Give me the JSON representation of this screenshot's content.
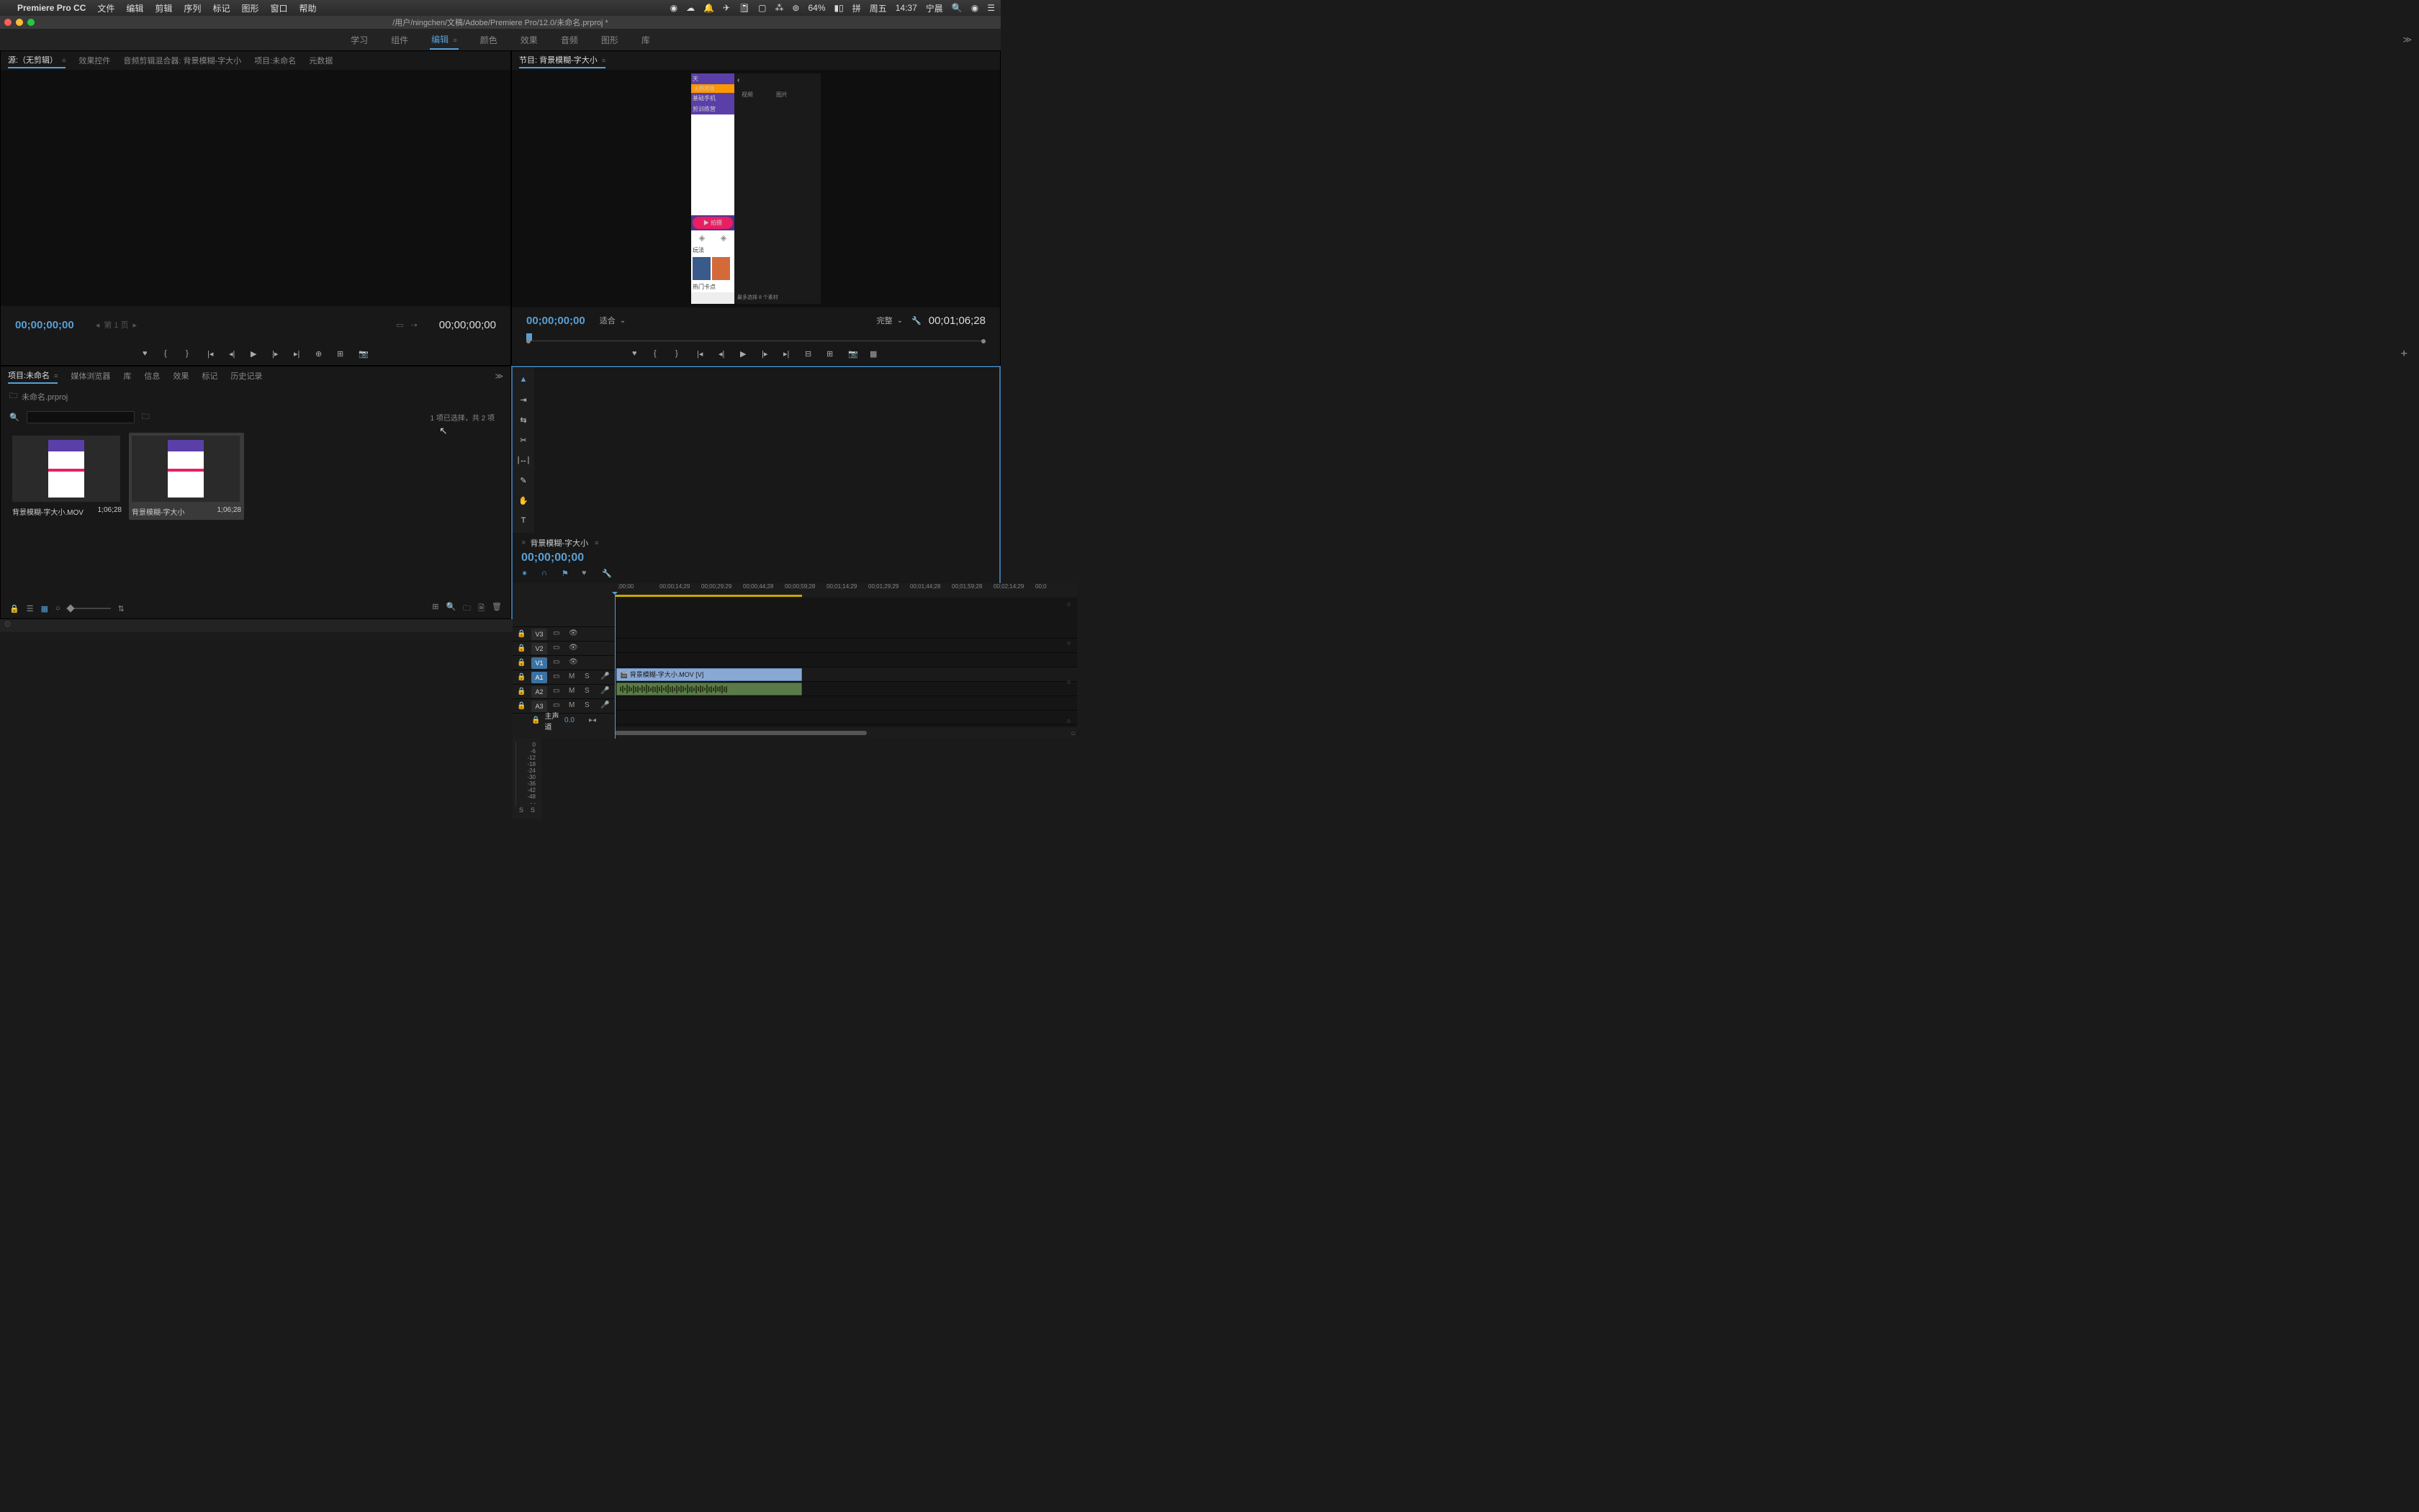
{
  "menubar": {
    "app": "Premiere Pro CC",
    "items": [
      "文件",
      "编辑",
      "剪辑",
      "序列",
      "标记",
      "图形",
      "窗口",
      "帮助"
    ],
    "battery": "64%",
    "day": "周五",
    "time": "14:37",
    "user": "宁晨"
  },
  "window": {
    "title": "/用户/ningchen/文稿/Adobe/Premiere Pro/12.0/未命名.prproj *"
  },
  "workspaces": {
    "items": [
      "学习",
      "组件",
      "编辑",
      "颜色",
      "效果",
      "音频",
      "图形",
      "库"
    ],
    "active": 2
  },
  "source": {
    "tabs": [
      "源:（无剪辑）",
      "效果控件",
      "音频剪辑混合器: 背景模糊-字大小",
      "项目:未命名",
      "元数据"
    ],
    "active": 0,
    "timecode_left": "00;00;00;00",
    "page_nav": "第 1 页",
    "timecode_right": "00;00;00;00"
  },
  "program": {
    "tab": "节目: 背景模糊-字大小",
    "timecode": "00;00;00;00",
    "fit": "适合",
    "quality": "完整",
    "duration": "00;01;06;28",
    "preview": {
      "tab1": "视频",
      "tab2": "图片",
      "banner1": "天",
      "banner2": "基础手机",
      "banner3": "剪训练营",
      "pill1": "拍摄",
      "section1": "玩法",
      "section2": "热门卡点",
      "hot_tag": "火热退场",
      "footer": "最多选择 8 个素材"
    }
  },
  "project": {
    "tabs": [
      "项目:未命名",
      "媒体浏览器",
      "库",
      "信息",
      "效果",
      "标记",
      "历史记录"
    ],
    "active": 0,
    "filename": "未命名.prproj",
    "status": "1 项已选择，共 2 项",
    "items": [
      {
        "name": "背景模糊-字大小.MOV",
        "duration": "1;06;28"
      },
      {
        "name": "背景模糊-字大小",
        "duration": "1;06;28"
      }
    ]
  },
  "timeline": {
    "sequence": "背景模糊-字大小",
    "timecode": "00;00;00;00",
    "ruler": [
      ";00;00",
      "00;00;14;29",
      "00;00;29;29",
      "00;00;44;28",
      "00;00;59;28",
      "00;01;14;29",
      "00;01;29;29",
      "00;01;44;28",
      "00;01;59;28",
      "00;02;14;29",
      "00;0"
    ],
    "video_tracks": [
      "V3",
      "V2",
      "V1"
    ],
    "audio_tracks": [
      "A1",
      "A2",
      "A3"
    ],
    "master": "主声道",
    "master_val": "0.0",
    "clip_name": "背景模糊-字大小.MOV [V]"
  },
  "meters": {
    "scale": [
      "0",
      "-6",
      "-12",
      "-18",
      "-24",
      "-30",
      "-36",
      "-42",
      "-48",
      "- -"
    ],
    "labels": [
      "S",
      "S"
    ]
  }
}
